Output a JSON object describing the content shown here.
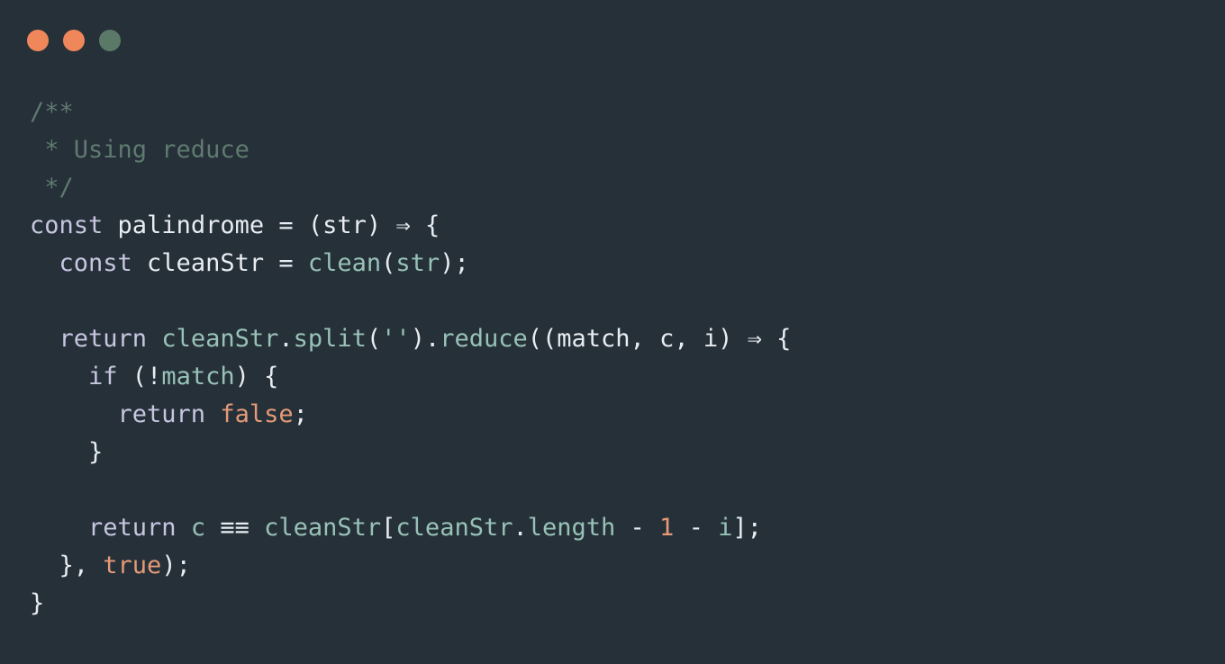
{
  "colors": {
    "background": "#263039",
    "close_dot": "#f0875a",
    "minimize_dot": "#f0875a",
    "zoom_dot": "#5a7a67",
    "comment": "#5f7a6f",
    "keyword": "#c7c6e0",
    "identifier": "#e8edf1",
    "function": "#98c2b7",
    "literal": "#e59a78"
  },
  "window_controls": [
    {
      "name": "close",
      "icon": "circle-icon"
    },
    {
      "name": "minimize",
      "icon": "circle-icon"
    },
    {
      "name": "zoom",
      "icon": "circle-icon"
    }
  ],
  "code": {
    "lines": [
      [
        {
          "t": "comment",
          "v": "/**"
        }
      ],
      [
        {
          "t": "comment",
          "v": " * Using reduce"
        }
      ],
      [
        {
          "t": "comment",
          "v": " */"
        }
      ],
      [
        {
          "t": "keyword",
          "v": "const "
        },
        {
          "t": "ident",
          "v": "palindrome "
        },
        {
          "t": "op",
          "v": "= "
        },
        {
          "t": "punct",
          "v": "("
        },
        {
          "t": "ident",
          "v": "str"
        },
        {
          "t": "punct",
          "v": ") "
        },
        {
          "t": "op",
          "v": "⇒ "
        },
        {
          "t": "punct",
          "v": "{"
        }
      ],
      [
        {
          "t": "keyword",
          "v": "  const "
        },
        {
          "t": "ident",
          "v": "cleanStr "
        },
        {
          "t": "op",
          "v": "= "
        },
        {
          "t": "func",
          "v": "clean"
        },
        {
          "t": "punct",
          "v": "("
        },
        {
          "t": "func",
          "v": "str"
        },
        {
          "t": "punct",
          "v": ");"
        }
      ],
      [],
      [
        {
          "t": "keyword",
          "v": "  return "
        },
        {
          "t": "func",
          "v": "cleanStr"
        },
        {
          "t": "punct",
          "v": "."
        },
        {
          "t": "func",
          "v": "split"
        },
        {
          "t": "punct",
          "v": "("
        },
        {
          "t": "string",
          "v": "''"
        },
        {
          "t": "punct",
          "v": ")."
        },
        {
          "t": "func",
          "v": "reduce"
        },
        {
          "t": "punct",
          "v": "(("
        },
        {
          "t": "ident",
          "v": "match"
        },
        {
          "t": "punct",
          "v": ", "
        },
        {
          "t": "ident",
          "v": "c"
        },
        {
          "t": "punct",
          "v": ", "
        },
        {
          "t": "ident",
          "v": "i"
        },
        {
          "t": "punct",
          "v": ") "
        },
        {
          "t": "op",
          "v": "⇒ "
        },
        {
          "t": "punct",
          "v": "{"
        }
      ],
      [
        {
          "t": "keyword",
          "v": "    if "
        },
        {
          "t": "punct",
          "v": "(!"
        },
        {
          "t": "func",
          "v": "match"
        },
        {
          "t": "punct",
          "v": ") {"
        }
      ],
      [
        {
          "t": "keyword",
          "v": "      return "
        },
        {
          "t": "literal",
          "v": "false"
        },
        {
          "t": "punct",
          "v": ";"
        }
      ],
      [
        {
          "t": "punct",
          "v": "    }"
        }
      ],
      [],
      [
        {
          "t": "keyword",
          "v": "    return "
        },
        {
          "t": "func",
          "v": "c "
        },
        {
          "t": "op",
          "v": "≡≡ "
        },
        {
          "t": "func",
          "v": "cleanStr"
        },
        {
          "t": "punct",
          "v": "["
        },
        {
          "t": "func",
          "v": "cleanStr"
        },
        {
          "t": "punct",
          "v": "."
        },
        {
          "t": "func",
          "v": "length "
        },
        {
          "t": "op",
          "v": "- "
        },
        {
          "t": "literal",
          "v": "1 "
        },
        {
          "t": "op",
          "v": "- "
        },
        {
          "t": "func",
          "v": "i"
        },
        {
          "t": "punct",
          "v": "];"
        }
      ],
      [
        {
          "t": "punct",
          "v": "  }, "
        },
        {
          "t": "literal",
          "v": "true"
        },
        {
          "t": "punct",
          "v": ");"
        }
      ],
      [
        {
          "t": "punct",
          "v": "}"
        }
      ]
    ]
  }
}
